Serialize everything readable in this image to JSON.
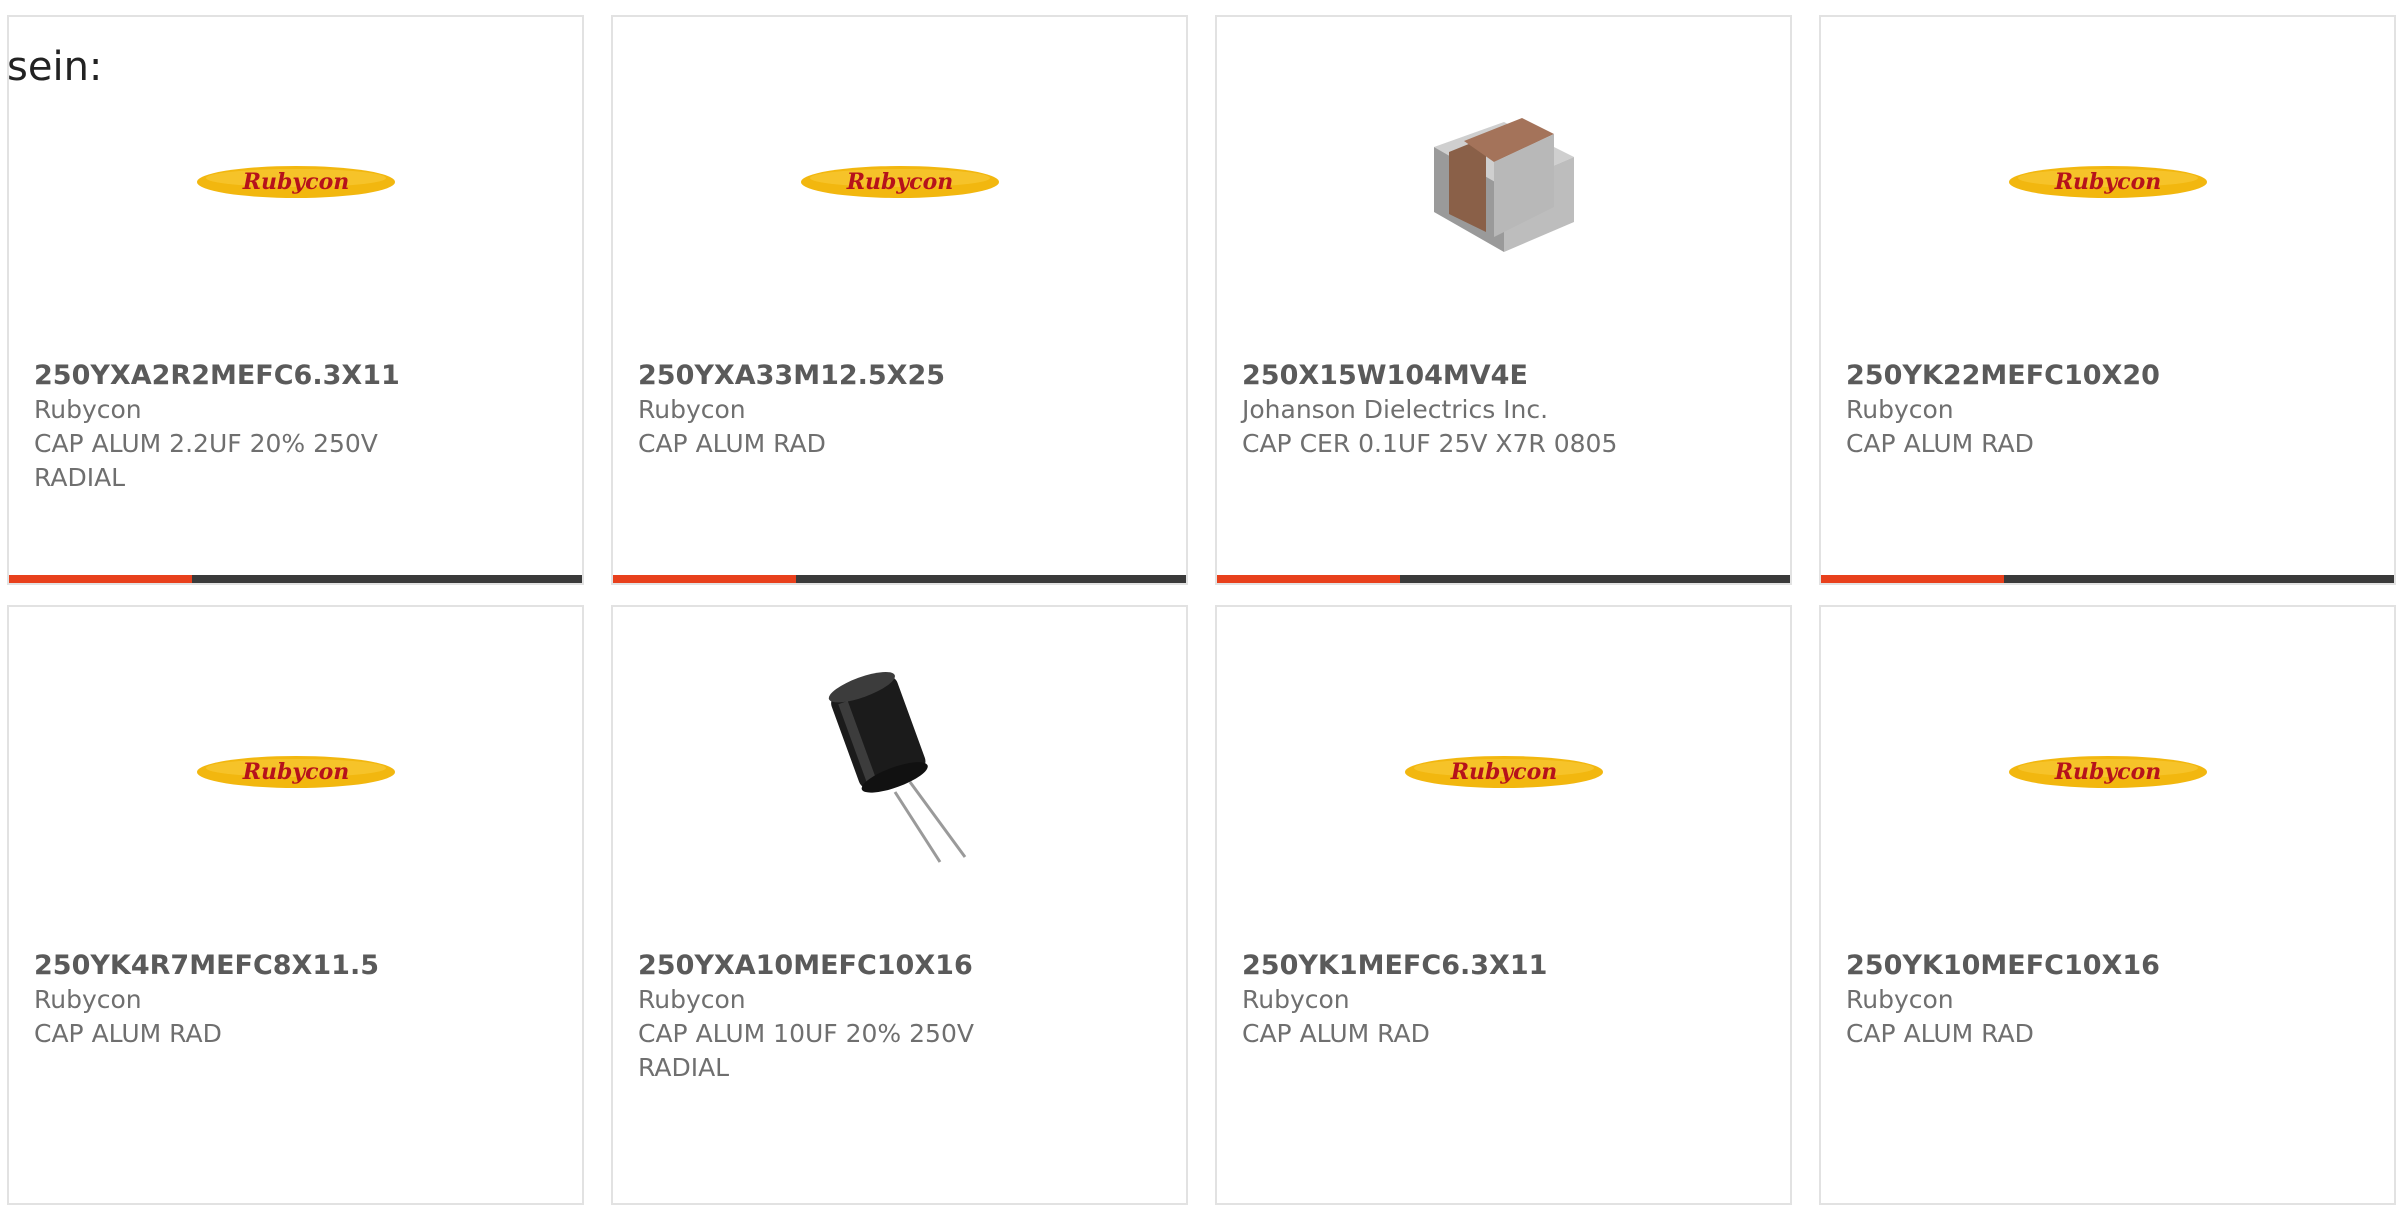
{
  "intro_text": "sein:",
  "brand_logo_text": "Rubycon",
  "colors": {
    "accent": "#e8401c",
    "bar": "#3a3a3a",
    "logo_fill": "#f2b70f",
    "logo_text": "#b6121b"
  },
  "cards": [
    {
      "part_number": "250YXA2R2MEFC6.3X11",
      "manufacturer": "Rubycon",
      "description": "CAP ALUM 2.2UF 20% 250V RADIAL",
      "image": "rubycon-logo"
    },
    {
      "part_number": "250YXA33M12.5X25",
      "manufacturer": "Rubycon",
      "description": "CAP ALUM RAD",
      "image": "rubycon-logo"
    },
    {
      "part_number": "250X15W104MV4E",
      "manufacturer": "Johanson Dielectrics Inc.",
      "description": "CAP CER 0.1UF 25V X7R 0805",
      "image": "ceramic-chip-capacitor"
    },
    {
      "part_number": "250YK22MEFC10X20",
      "manufacturer": "Rubycon",
      "description": "CAP ALUM RAD",
      "image": "rubycon-logo"
    },
    {
      "part_number": "250YK4R7MEFC8X11.5",
      "manufacturer": "Rubycon",
      "description": "CAP ALUM RAD",
      "image": "rubycon-logo"
    },
    {
      "part_number": "250YXA10MEFC10X16",
      "manufacturer": "Rubycon",
      "description": "CAP ALUM 10UF 20% 250V RADIAL",
      "image": "electrolytic-capacitor"
    },
    {
      "part_number": "250YK1MEFC6.3X11",
      "manufacturer": "Rubycon",
      "description": "CAP ALUM RAD",
      "image": "rubycon-logo"
    },
    {
      "part_number": "250YK10MEFC10X16",
      "manufacturer": "Rubycon",
      "description": "CAP ALUM RAD",
      "image": "rubycon-logo"
    }
  ]
}
